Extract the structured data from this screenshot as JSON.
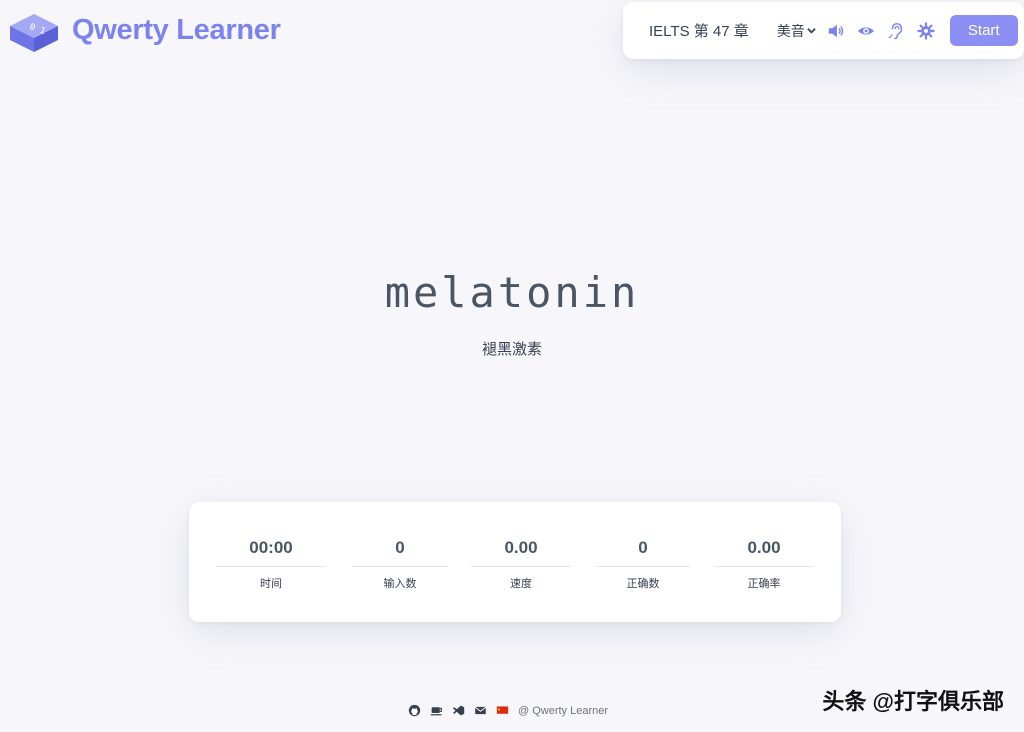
{
  "brand": {
    "title": "Qwerty Learner"
  },
  "toolbar": {
    "dictionary": "IELTS 第 47 章",
    "accent": "美音",
    "start_label": "Start",
    "icons": [
      "volume-icon",
      "eye-icon",
      "ear-icon",
      "settings-icon"
    ]
  },
  "word": {
    "text": "melatonin",
    "translation": "褪黑激素"
  },
  "stats": [
    {
      "value": "00:00",
      "label": "时间"
    },
    {
      "value": "0",
      "label": "输入数"
    },
    {
      "value": "0.00",
      "label": "速度"
    },
    {
      "value": "0",
      "label": "正确数"
    },
    {
      "value": "0.00",
      "label": "正确率"
    }
  ],
  "footer": {
    "icons": [
      "github-icon",
      "coffee-icon",
      "vscode-icon",
      "mail-icon",
      "flag-icon"
    ],
    "credit": "@ Qwerty Learner"
  },
  "watermark": "头条 @打字俱乐部",
  "colors": {
    "accent": "#7c83f0",
    "button": "#8b8ff3",
    "background": "#f7f7fb"
  }
}
